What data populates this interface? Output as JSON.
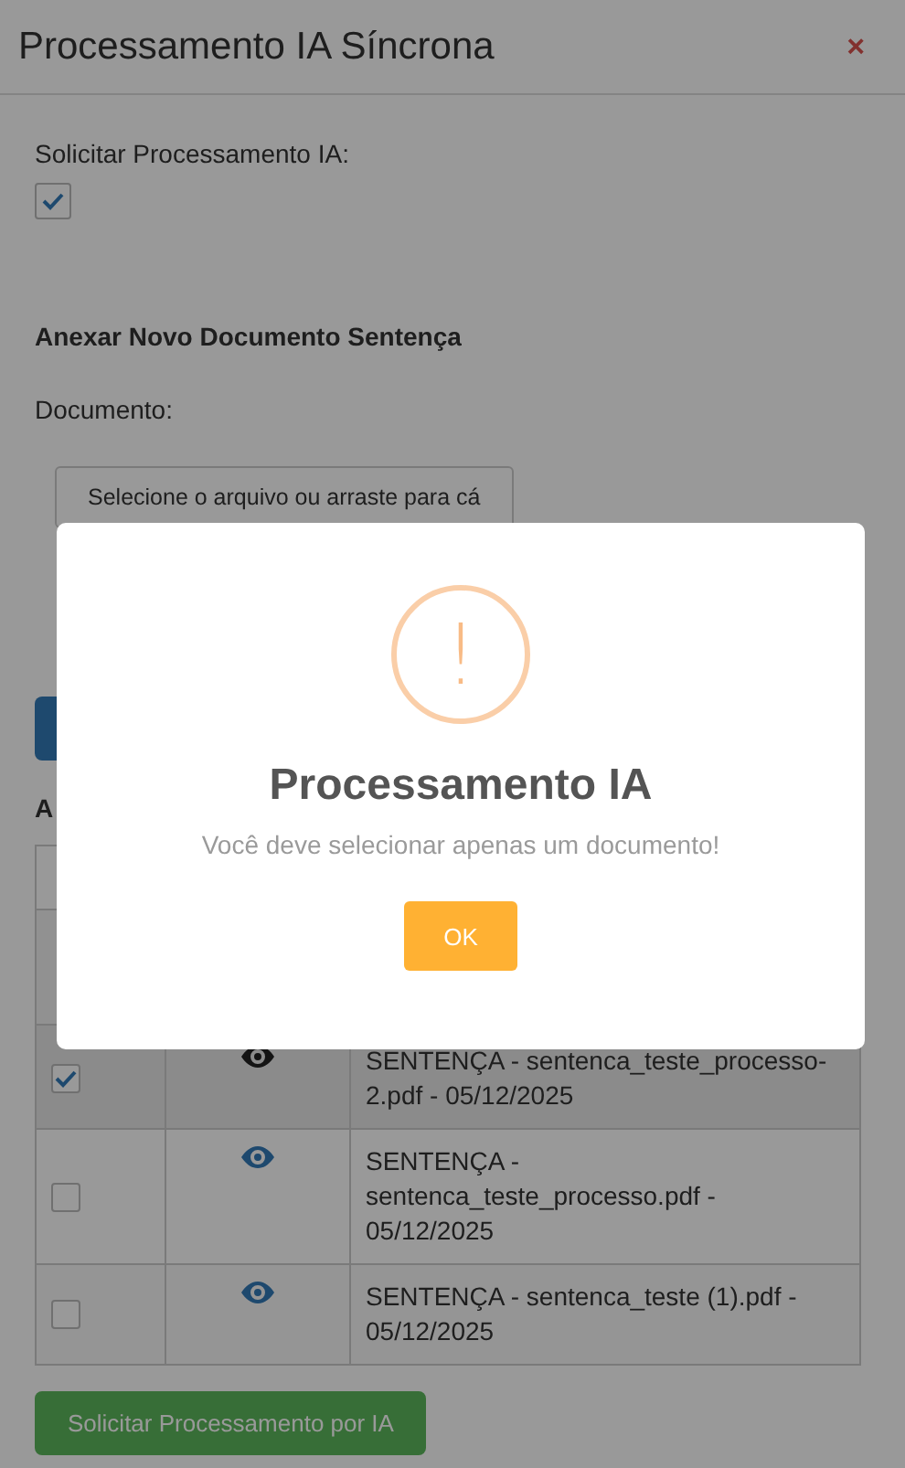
{
  "window": {
    "title": "Processamento IA Síncrona",
    "close": "×"
  },
  "form": {
    "request_label": "Solicitar Processamento IA:",
    "request_checked": true,
    "section_heading": "Anexar Novo Documento Sentença",
    "document_label": "Documento:",
    "file_button": "Selecione o arquivo ou arraste para cá",
    "partial_heading": "A"
  },
  "table": {
    "rows": [
      {
        "selected": true,
        "document": "SENTENÇA - sentenca_teste_processo-2.pdf - 05/12/2025"
      },
      {
        "selected": false,
        "document": "SENTENÇA - sentenca_teste_processo.pdf - 05/12/2025"
      },
      {
        "selected": false,
        "document": "SENTENÇA - sentenca_teste (1).pdf - 05/12/2025"
      }
    ]
  },
  "submit_button": "Solicitar Processamento por IA",
  "dialog": {
    "kind": "warning",
    "icon": "!",
    "title": "Processamento IA",
    "message": "Você deve selecionar apenas um documento!",
    "ok_button": "OK"
  }
}
